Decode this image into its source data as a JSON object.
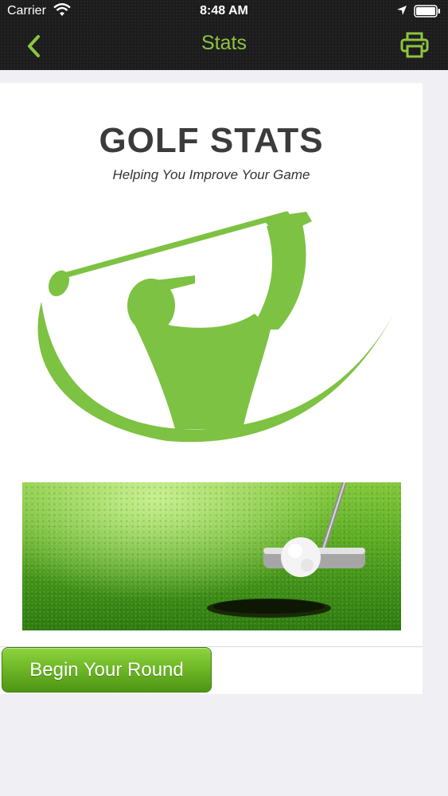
{
  "status_bar": {
    "carrier": "Carrier",
    "time": "8:48 AM"
  },
  "nav": {
    "title": "Stats",
    "back_icon": "chevron-left-icon",
    "print_icon": "printer-icon"
  },
  "hero": {
    "title": "GOLF STATS",
    "tagline": "Helping You Improve Your Game"
  },
  "images": {
    "logo": "golfer-swing-logo",
    "photo": "putting-green-photo"
  },
  "actions": {
    "begin_round": "Begin Your Round"
  },
  "colors": {
    "accent": "#8cc540",
    "nav_bg": "#1c1c1c",
    "button": "#6cb525"
  }
}
